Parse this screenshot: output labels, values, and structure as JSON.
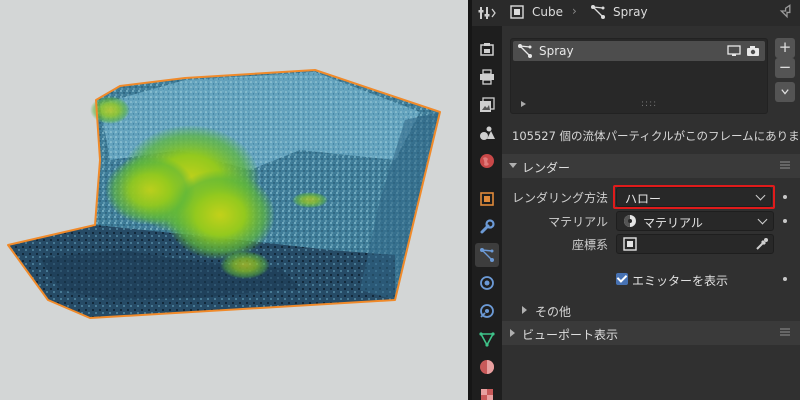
{
  "header": {
    "object_name": "Cube",
    "particle_system_name": "Spray"
  },
  "particle_list": {
    "items": [
      {
        "name": "Spray",
        "selected": true
      }
    ]
  },
  "list_buttons": {
    "add": "+",
    "remove": "−"
  },
  "info_text": "105527 個の流体パーティクルがこのフレームにありま…",
  "render_panel": {
    "title": "レンダー",
    "render_as_label": "レンダリング方法",
    "render_as_value": "ハロー",
    "material_label": "マテリアル",
    "material_value": "マテリアル",
    "coordinate_label": "座標系",
    "show_emitter_label": "エミッターを表示",
    "show_emitter_checked": true,
    "other_label": "その他"
  },
  "viewport_display_panel": {
    "title": "ビューポート表示"
  },
  "colors": {
    "highlight": "#e01b1b",
    "accent": "#4772b3",
    "selection_outline": "#f08a2a"
  },
  "tabs": [
    {
      "icon": "tool-icon"
    },
    {
      "icon": "render-icon"
    },
    {
      "icon": "output-icon"
    },
    {
      "icon": "view-layer-icon"
    },
    {
      "icon": "scene-icon"
    },
    {
      "icon": "world-icon"
    },
    {
      "icon": "object-icon"
    },
    {
      "icon": "modifier-icon"
    },
    {
      "icon": "particles-icon",
      "active": true
    },
    {
      "icon": "physics-icon"
    },
    {
      "icon": "constraints-icon"
    },
    {
      "icon": "object-data-icon"
    },
    {
      "icon": "material-icon"
    }
  ]
}
